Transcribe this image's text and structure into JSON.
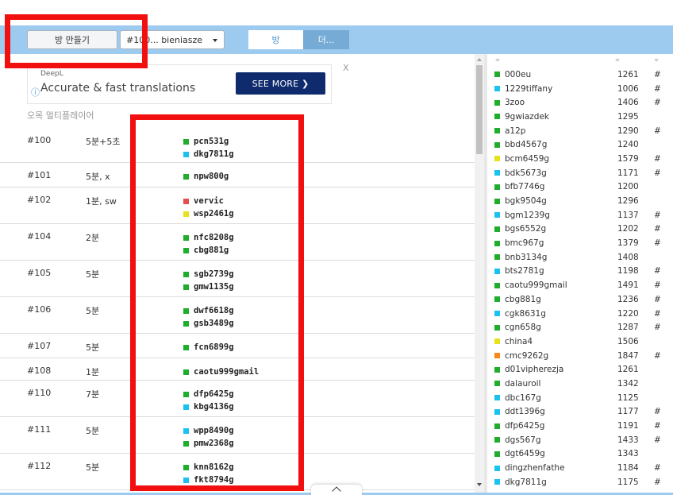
{
  "toolbar": {
    "make_room_label": "방 만들기",
    "room_select_value": "#100... bieniasze",
    "tab_room_label": "방",
    "tab_more_label": "더..."
  },
  "ad": {
    "brand": "DeepL",
    "info_icon": "info-icon",
    "text": "Accurate & fast translations",
    "button_label": "SEE MORE ❯",
    "close_label": "X"
  },
  "section_title": "오목 멀티플레이어",
  "colors": {
    "green": "#1fad2b",
    "cyan": "#1bc1ef",
    "red": "#e84c4c",
    "yellow": "#e9e21a",
    "orange": "#f5891e",
    "topbar": "#9dcbf0",
    "annotation": "#f20f0f"
  },
  "rooms": [
    {
      "id": "#100",
      "time": "5분+5초",
      "players": [
        {
          "name": "pcn531g",
          "color": "#1fad2b"
        },
        {
          "name": "dkg7811g",
          "color": "#1bc1ef"
        }
      ]
    },
    {
      "id": "#101",
      "time": "5분, x",
      "players": [
        {
          "name": "npw800g",
          "color": "#1fad2b"
        }
      ]
    },
    {
      "id": "#102",
      "time": "1분, sw",
      "players": [
        {
          "name": "vervic",
          "color": "#e84c4c"
        },
        {
          "name": "wsp2461g",
          "color": "#e9e21a"
        }
      ]
    },
    {
      "id": "#104",
      "time": "2분",
      "players": [
        {
          "name": "nfc8208g",
          "color": "#1fad2b"
        },
        {
          "name": "cbg881g",
          "color": "#1fad2b"
        }
      ]
    },
    {
      "id": "#105",
      "time": "5분",
      "players": [
        {
          "name": "sgb2739g",
          "color": "#1fad2b"
        },
        {
          "name": "gmw1135g",
          "color": "#1fad2b"
        }
      ]
    },
    {
      "id": "#106",
      "time": "5분",
      "players": [
        {
          "name": "dwf6618g",
          "color": "#1fad2b"
        },
        {
          "name": "gsb3489g",
          "color": "#1fad2b"
        }
      ]
    },
    {
      "id": "#107",
      "time": "5분",
      "players": [
        {
          "name": "fcn6899g",
          "color": "#1fad2b"
        }
      ]
    },
    {
      "id": "#108",
      "time": "1분",
      "players": [
        {
          "name": "caotu999gmail",
          "color": "#1fad2b"
        }
      ]
    },
    {
      "id": "#110",
      "time": "7분",
      "players": [
        {
          "name": "dfp6425g",
          "color": "#1fad2b"
        },
        {
          "name": "kbg4136g",
          "color": "#1bc1ef"
        }
      ]
    },
    {
      "id": "#111",
      "time": "5분",
      "players": [
        {
          "name": "wpp8490g",
          "color": "#1bc1ef"
        },
        {
          "name": "pmw2368g",
          "color": "#1fad2b"
        }
      ]
    },
    {
      "id": "#112",
      "time": "5분",
      "players": [
        {
          "name": "knn8162g",
          "color": "#1fad2b"
        },
        {
          "name": "fkt8794g",
          "color": "#1bc1ef"
        }
      ]
    }
  ],
  "users": [
    {
      "name": "000eu",
      "rating": "1261",
      "mark": "#",
      "color": "#1fad2b"
    },
    {
      "name": "1229tiffany",
      "rating": "1006",
      "mark": "#",
      "color": "#1bc1ef"
    },
    {
      "name": "3zoo",
      "rating": "1406",
      "mark": "#",
      "color": "#1fad2b"
    },
    {
      "name": "9gwiazdek",
      "rating": "1295",
      "mark": "",
      "color": "#1fad2b"
    },
    {
      "name": "a12p",
      "rating": "1290",
      "mark": "#",
      "color": "#1fad2b"
    },
    {
      "name": "bbd4567g",
      "rating": "1240",
      "mark": "",
      "color": "#1fad2b"
    },
    {
      "name": "bcm6459g",
      "rating": "1579",
      "mark": "#",
      "color": "#e9e21a"
    },
    {
      "name": "bdk5673g",
      "rating": "1171",
      "mark": "#",
      "color": "#1bc1ef"
    },
    {
      "name": "bfb7746g",
      "rating": "1200",
      "mark": "",
      "color": "#1fad2b"
    },
    {
      "name": "bgk9504g",
      "rating": "1296",
      "mark": "",
      "color": "#1fad2b"
    },
    {
      "name": "bgm1239g",
      "rating": "1137",
      "mark": "#",
      "color": "#1bc1ef"
    },
    {
      "name": "bgs6552g",
      "rating": "1202",
      "mark": "#",
      "color": "#1fad2b"
    },
    {
      "name": "bmc967g",
      "rating": "1379",
      "mark": "#",
      "color": "#1fad2b"
    },
    {
      "name": "bnb3134g",
      "rating": "1408",
      "mark": "",
      "color": "#1fad2b"
    },
    {
      "name": "bts2781g",
      "rating": "1198",
      "mark": "#",
      "color": "#1bc1ef"
    },
    {
      "name": "caotu999gmail",
      "rating": "1491",
      "mark": "#",
      "color": "#1fad2b"
    },
    {
      "name": "cbg881g",
      "rating": "1236",
      "mark": "#",
      "color": "#1fad2b"
    },
    {
      "name": "cgk8631g",
      "rating": "1220",
      "mark": "#",
      "color": "#1bc1ef"
    },
    {
      "name": "cgn658g",
      "rating": "1287",
      "mark": "#",
      "color": "#1fad2b"
    },
    {
      "name": "china4",
      "rating": "1506",
      "mark": "",
      "color": "#e9e21a"
    },
    {
      "name": "cmc9262g",
      "rating": "1847",
      "mark": "#",
      "color": "#f5891e"
    },
    {
      "name": "d01vipherezja",
      "rating": "1261",
      "mark": "",
      "color": "#1fad2b"
    },
    {
      "name": "dalauroil",
      "rating": "1342",
      "mark": "",
      "color": "#1fad2b"
    },
    {
      "name": "dbc167g",
      "rating": "1125",
      "mark": "",
      "color": "#1bc1ef"
    },
    {
      "name": "ddt1396g",
      "rating": "1177",
      "mark": "#",
      "color": "#1bc1ef"
    },
    {
      "name": "dfp6425g",
      "rating": "1191",
      "mark": "#",
      "color": "#1fad2b"
    },
    {
      "name": "dgs567g",
      "rating": "1433",
      "mark": "#",
      "color": "#1fad2b"
    },
    {
      "name": "dgt6459g",
      "rating": "1343",
      "mark": "",
      "color": "#1fad2b"
    },
    {
      "name": "dingzhenfathe",
      "rating": "1184",
      "mark": "#",
      "color": "#1bc1ef"
    },
    {
      "name": "dkg7811g",
      "rating": "1175",
      "mark": "#",
      "color": "#1bc1ef"
    }
  ]
}
